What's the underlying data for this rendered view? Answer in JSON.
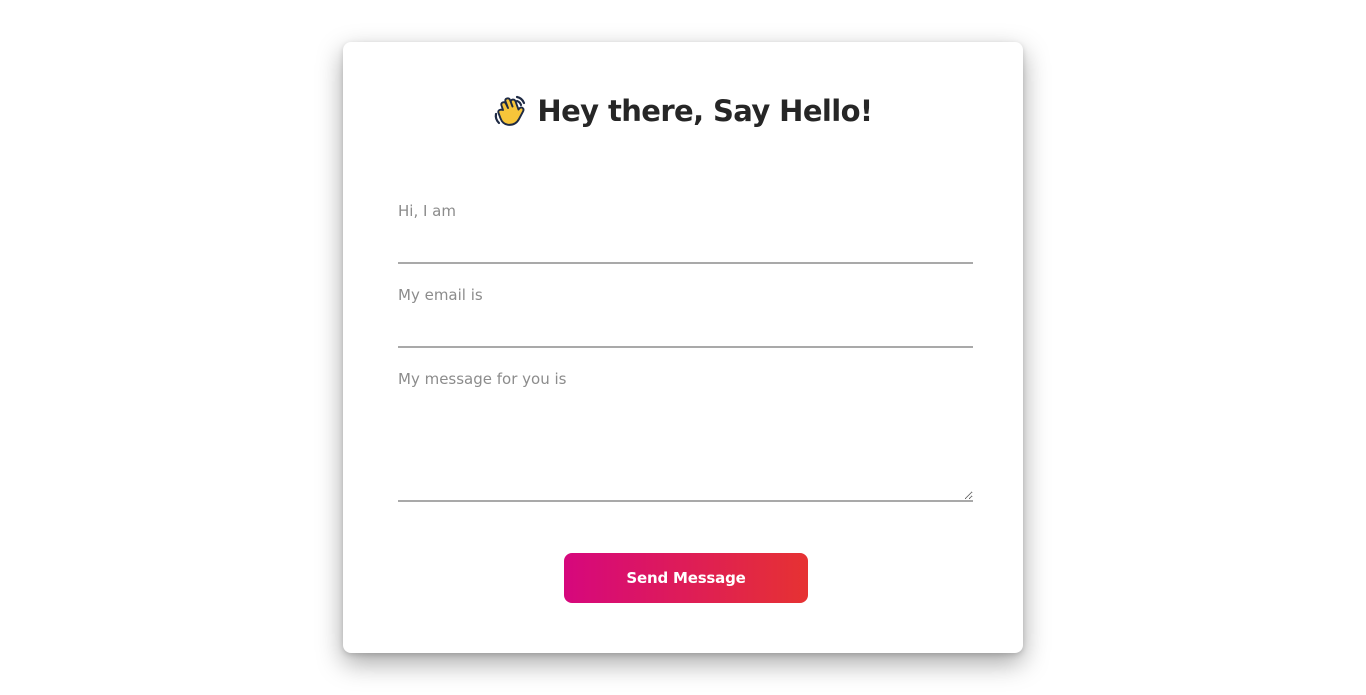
{
  "form": {
    "title": "Hey there, Say Hello!",
    "title_icon": "waving-hand-icon",
    "fields": {
      "name": {
        "label": "Hi, I am",
        "value": ""
      },
      "email": {
        "label": "My email is",
        "value": ""
      },
      "message": {
        "label": "My message for you is",
        "value": ""
      }
    },
    "submit_label": "Send Message"
  },
  "colors": {
    "button_gradient_start": "#d6077d",
    "button_gradient_end": "#e63232",
    "title": "#262626",
    "label": "#8c8c8c",
    "underline": "#a9a9a9",
    "icon_yellow": "#f7c53a",
    "icon_outline": "#1e2a44"
  }
}
